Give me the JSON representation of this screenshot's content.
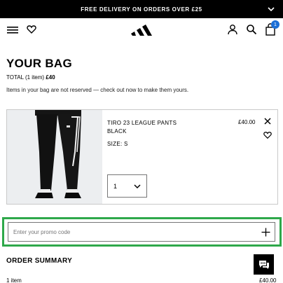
{
  "promo_bar": {
    "text": "FREE DELIVERY ON ORDERS OVER £25"
  },
  "header": {
    "icons": [
      "menu-icon",
      "heart-icon",
      "adidas-logo",
      "account-icon",
      "search-icon",
      "bag-icon"
    ],
    "cart_count": "1"
  },
  "bag": {
    "title": "YOUR BAG",
    "total_label": "TOTAL (1 item)",
    "total_price": "£40",
    "note": "Items in your bag are not reserved — check out now to make them yours."
  },
  "item": {
    "name": "TIRO 23 LEAGUE PANTS BLACK",
    "price": "£40.00",
    "size": "SIZE: S",
    "quantity": "1"
  },
  "promo": {
    "placeholder": "Enter your promo code"
  },
  "summary": {
    "title": "ORDER SUMMARY",
    "count": "1 item",
    "price": "£40.00"
  },
  "colors": {
    "accent": "#2ea84a",
    "badge": "#1c6fd6",
    "bar": "#000000"
  }
}
